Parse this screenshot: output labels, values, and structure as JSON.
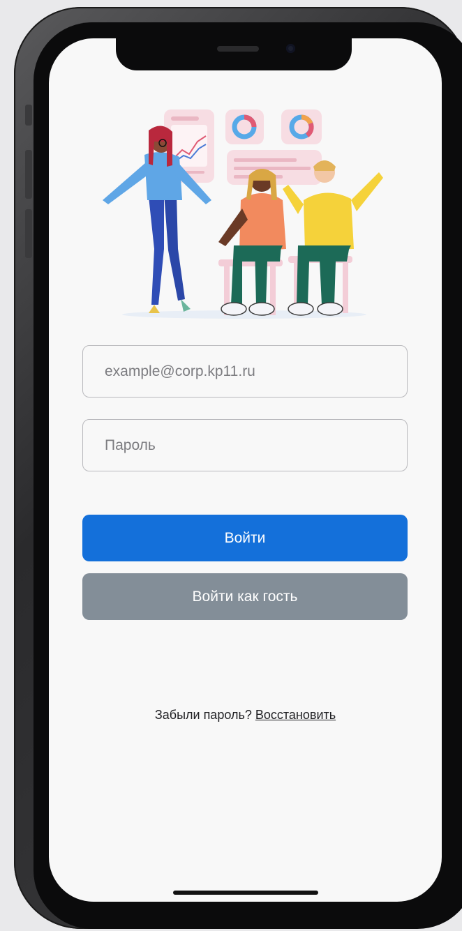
{
  "login": {
    "email_placeholder": "example@corp.kp11.ru",
    "password_placeholder": "Пароль",
    "login_button": "Войти",
    "guest_button": "Войти как гость",
    "forgot_text": "Забыли пароль?",
    "restore_link": "Восстановить"
  },
  "colors": {
    "primary": "#1470da",
    "guest": "#838e98",
    "background": "#f8f8f8"
  },
  "icons": [
    "team-illustration"
  ]
}
